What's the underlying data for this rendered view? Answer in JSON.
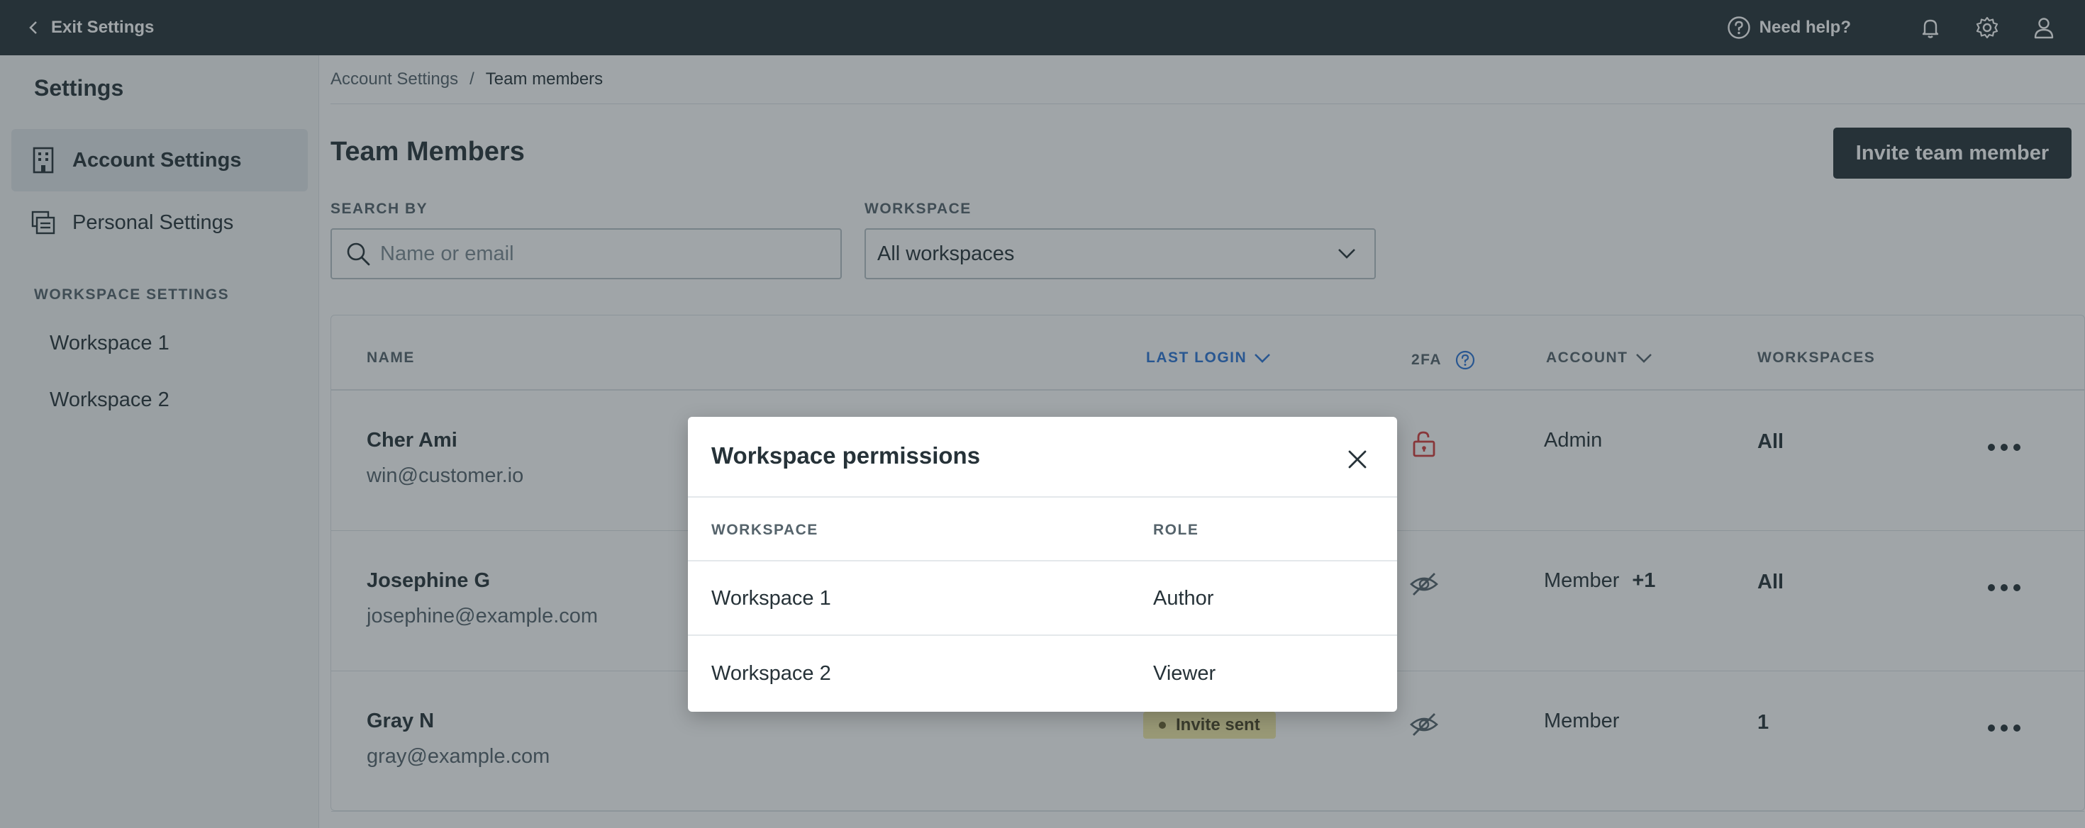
{
  "topbar": {
    "exit_label": "Exit Settings",
    "help_label": "Need help?",
    "icons": [
      "help-circle-icon",
      "bell-icon",
      "gear-icon",
      "user-icon"
    ]
  },
  "sidebar": {
    "title": "Settings",
    "items": [
      {
        "label": "Account Settings",
        "icon": "building-icon",
        "active": true
      },
      {
        "label": "Personal Settings",
        "icon": "personal-card-icon",
        "active": false
      }
    ],
    "section_label": "WORKSPACE SETTINGS",
    "workspaces": [
      "Workspace 1",
      "Workspace 2"
    ]
  },
  "breadcrumb": {
    "parent": "Account Settings",
    "separator": "/",
    "current": "Team members"
  },
  "page": {
    "title": "Team Members",
    "invite_button": "Invite team member"
  },
  "filters": {
    "search_label": "SEARCH BY",
    "search_placeholder": "Name or email",
    "workspace_label": "WORKSPACE",
    "workspace_value": "All workspaces"
  },
  "table": {
    "columns": {
      "name": "NAME",
      "last_login": "LAST LOGIN",
      "twofa": "2FA",
      "account": "ACCOUNT",
      "workspaces": "WORKSPACES"
    },
    "rows": [
      {
        "name": "Cher Ami",
        "email": "win@customer.io",
        "twofa": "unlocked-lock-icon",
        "account": "Admin",
        "account_extra": "",
        "workspaces": "All",
        "status": ""
      },
      {
        "name": "Josephine G",
        "email": "josephine@example.com",
        "twofa": "eye-slash-icon",
        "account": "Member",
        "account_extra": "+1",
        "workspaces": "All",
        "status": ""
      },
      {
        "name": "Gray N",
        "email": "gray@example.com",
        "twofa": "eye-slash-icon",
        "account": "Member",
        "account_extra": "",
        "workspaces": "1",
        "status": "Invite sent"
      }
    ]
  },
  "modal": {
    "title": "Workspace permissions",
    "col_workspace": "WORKSPACE",
    "col_role": "ROLE",
    "rows": [
      {
        "workspace": "Workspace 1",
        "role": "Author"
      },
      {
        "workspace": "Workspace 2",
        "role": "Viewer"
      }
    ]
  },
  "colors": {
    "topbar": "#263238",
    "accent_link": "#2c74d6",
    "danger": "#d43c3c",
    "badge": "#f3e9a6"
  }
}
